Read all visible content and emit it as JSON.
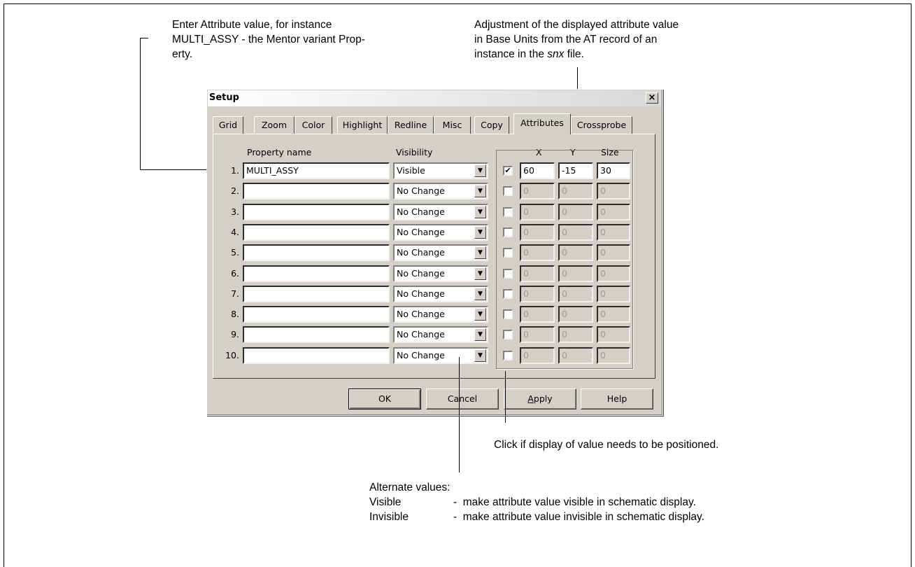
{
  "annotations": {
    "property_note": [
      "Enter Attribute value, for instance",
      "MULTI_ASSY - the Mentor variant Prop-",
      "erty."
    ],
    "adjust_note": {
      "line1": "Adjustment of the displayed attribute value",
      "line2": "in Base Units from the AT record of an",
      "line3_pre": "instance in the ",
      "line3_em": "snx",
      "line3_post": " file."
    },
    "click_note": "Click if display of value needs to be positioned.",
    "alternate": {
      "heading": "Alternate values:",
      "items": [
        {
          "term": "Visible",
          "desc": "-  make attribute value visible in schematic display."
        },
        {
          "term": "Invisible",
          "desc": "-  make attribute value invisible in schematic display."
        }
      ]
    }
  },
  "dialog": {
    "title": "Setup",
    "close_glyph": "×",
    "tabs": [
      "Grid",
      "Zoom",
      "Color",
      "Highlight",
      "Redline",
      "Misc",
      "Copy",
      "Attributes",
      "Crossprobe"
    ],
    "active_tab": "Attributes",
    "headers": {
      "property": "Property name",
      "visibility": "Visibility",
      "x": "X",
      "y": "Y",
      "size": "Size"
    },
    "rows": [
      {
        "num": "1.",
        "name": "MULTI_ASSY",
        "visibility": "Visible",
        "checked": true,
        "x": "60",
        "y": "-15",
        "size": "30"
      },
      {
        "num": "2.",
        "name": "",
        "visibility": "No Change",
        "checked": false,
        "x": "0",
        "y": "0",
        "size": "0"
      },
      {
        "num": "3.",
        "name": "",
        "visibility": "No Change",
        "checked": false,
        "x": "0",
        "y": "0",
        "size": "0"
      },
      {
        "num": "4.",
        "name": "",
        "visibility": "No Change",
        "checked": false,
        "x": "0",
        "y": "0",
        "size": "0"
      },
      {
        "num": "5.",
        "name": "",
        "visibility": "No Change",
        "checked": false,
        "x": "0",
        "y": "0",
        "size": "0"
      },
      {
        "num": "6.",
        "name": "",
        "visibility": "No Change",
        "checked": false,
        "x": "0",
        "y": "0",
        "size": "0"
      },
      {
        "num": "7.",
        "name": "",
        "visibility": "No Change",
        "checked": false,
        "x": "0",
        "y": "0",
        "size": "0"
      },
      {
        "num": "8.",
        "name": "",
        "visibility": "No Change",
        "checked": false,
        "x": "0",
        "y": "0",
        "size": "0"
      },
      {
        "num": "9.",
        "name": "",
        "visibility": "No Change",
        "checked": false,
        "x": "0",
        "y": "0",
        "size": "0"
      },
      {
        "num": "10.",
        "name": "",
        "visibility": "No Change",
        "checked": false,
        "x": "0",
        "y": "0",
        "size": "0"
      }
    ],
    "checkmark": "✔",
    "dropdown_glyph": "▼",
    "buttons": {
      "ok": "OK",
      "cancel": "Cancel",
      "apply": "Apply",
      "help": "Help"
    }
  }
}
